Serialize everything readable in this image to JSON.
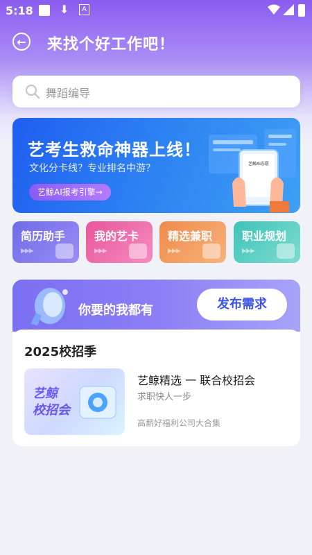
{
  "status_bar": {
    "time": "5:18",
    "a_badge": "A"
  },
  "header": {
    "title": "来找个好工作吧！"
  },
  "search": {
    "placeholder": "舞蹈编导"
  },
  "banner": {
    "title": "艺考生救命神器上线！",
    "subtitle": "文化分卡线？专业排名中游？",
    "cta_label": "艺鲸AI报考引擎→",
    "phone_label": "艺鲸AI志愿"
  },
  "tiles": [
    {
      "label": "简历助手",
      "color_from": "#6f6be8",
      "color_to": "#9a8df5"
    },
    {
      "label": "我的艺卡",
      "color_from": "#e8569a",
      "color_to": "#f58cc0"
    },
    {
      "label": "精选兼职",
      "color_from": "#f08a4a",
      "color_to": "#f7b37c"
    },
    {
      "label": "职业规划",
      "color_from": "#3ec3b8",
      "color_to": "#7fdcd0"
    }
  ],
  "promo_card": {
    "tagline": "你要的我都有",
    "publish_label": "发布需求",
    "section_title": "2025校招季",
    "image_text_1": "艺鲸",
    "image_text_2": "校招会",
    "item_title": "艺鲸精选 一 联合校招会",
    "item_subtitle": "求职快人一步",
    "item_note": "高薪好福利公司大合集"
  }
}
